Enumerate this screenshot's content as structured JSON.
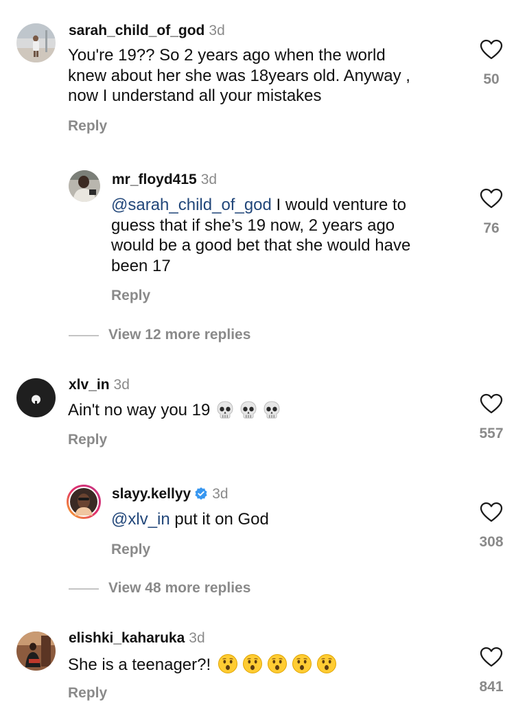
{
  "comments": [
    {
      "username": "sarah_child_of_god",
      "time": "3d",
      "lines": [
        "You're 19?? So 2 years ago when the world",
        "knew about her she was 18years old. Anyway ,",
        "now I understand all your mistakes"
      ],
      "reply": "Reply",
      "likes": "50"
    },
    {
      "username": "mr_floyd415",
      "time": "3d",
      "mention": "@sarah_child_of_god",
      "lines": [
        " I would venture to",
        "guess that if she’s 19 now, 2 years ago",
        "would be a good bet that she would have",
        "been 17"
      ],
      "reply": "Reply",
      "likes": "76"
    },
    {
      "view_replies": "View 12 more replies"
    },
    {
      "username": "xlv_in",
      "time": "3d",
      "text": "Ain't no way you 19",
      "emoji": [
        "skull",
        "skull",
        "skull"
      ],
      "reply": "Reply",
      "likes": "557"
    },
    {
      "username": "slayy.kellyy",
      "verified": true,
      "time": "3d",
      "mention": "@xlv_in",
      "text": " put it on God",
      "reply": "Reply",
      "likes": "308"
    },
    {
      "view_replies": "View 48 more replies"
    },
    {
      "username": "elishki_kaharuka",
      "time": "3d",
      "text": "She is a teenager?!",
      "emoji": [
        "hushed-face",
        "hushed-face",
        "hushed-face",
        "hushed-face",
        "hushed-face"
      ],
      "reply": "Reply",
      "likes": "841"
    }
  ],
  "icons": {
    "like": "heart-outline-icon",
    "verified": "verified-badge-icon"
  },
  "colors": {
    "text": "#111111",
    "muted": "#8a8a8a",
    "mention": "#22477a",
    "verified": "#3897f0"
  }
}
